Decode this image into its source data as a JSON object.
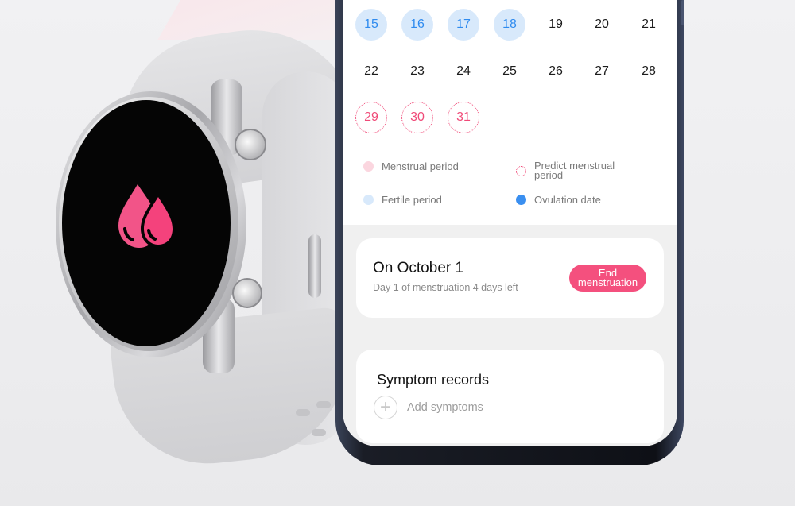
{
  "colors": {
    "accent": "#f4507e",
    "fertile_fill": "#d8e9fb",
    "fertile_text": "#2f8bef",
    "predict": "#f04a78",
    "menstrual": "#fbd6df",
    "ovulation": "#3a8ff0"
  },
  "watch": {
    "icon": "blood-drops-icon"
  },
  "calendar": {
    "rows": [
      [
        {
          "d": "15",
          "t": "fertile"
        },
        {
          "d": "16",
          "t": "fertile"
        },
        {
          "d": "17",
          "t": "fertile"
        },
        {
          "d": "18",
          "t": "fertile"
        },
        {
          "d": "19",
          "t": ""
        },
        {
          "d": "20",
          "t": ""
        },
        {
          "d": "21",
          "t": ""
        }
      ],
      [
        {
          "d": "22",
          "t": ""
        },
        {
          "d": "23",
          "t": ""
        },
        {
          "d": "24",
          "t": ""
        },
        {
          "d": "25",
          "t": ""
        },
        {
          "d": "26",
          "t": ""
        },
        {
          "d": "27",
          "t": ""
        },
        {
          "d": "28",
          "t": ""
        }
      ],
      [
        {
          "d": "29",
          "t": "predict"
        },
        {
          "d": "30",
          "t": "predict"
        },
        {
          "d": "31",
          "t": "predict"
        }
      ]
    ]
  },
  "legend": {
    "menstrual": "Menstrual period",
    "predict": "Predict menstrual period",
    "fertile": "Fertile period",
    "ovulation": "Ovulation date"
  },
  "period_card": {
    "title": "On October 1",
    "subtitle": "Day 1 of menstruation 4 days left",
    "button": "End menstruation"
  },
  "symptom_card": {
    "title": "Symptom records",
    "add_label": "Add symptoms",
    "add_icon": "plus-icon"
  }
}
